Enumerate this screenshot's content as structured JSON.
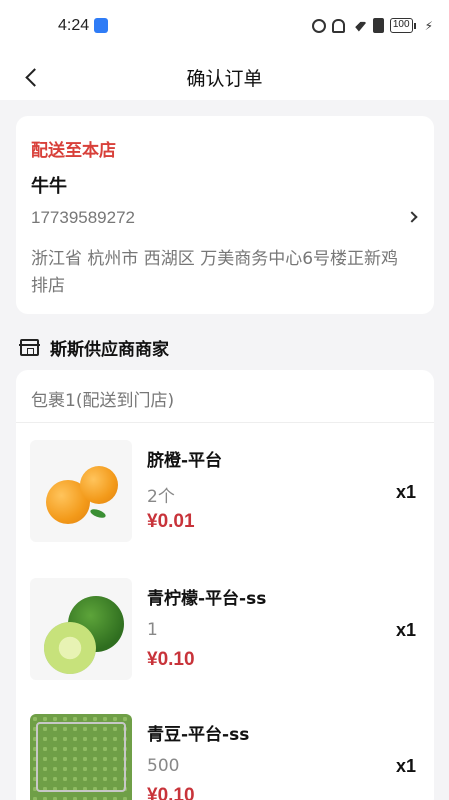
{
  "status_bar": {
    "time": "4:24",
    "battery": "100",
    "icons": [
      "alarm-icon",
      "mute-icon",
      "wifi-icon",
      "sim-icon",
      "battery-icon",
      "charging-icon"
    ]
  },
  "nav": {
    "title": "确认订单",
    "back_icon": "chevron-left-icon"
  },
  "address": {
    "delivery_label": "配送至本店",
    "name": "牛牛",
    "phone": "17739589272",
    "address": "浙江省 杭州市 西湖区 万美商务中心6号楼正新鸡排店"
  },
  "store": {
    "name": "斯斯供应商商家",
    "icon": "store-icon"
  },
  "package": {
    "title": "包裹1(配送到门店)",
    "items": [
      {
        "name": "脐橙-平台",
        "spec": "2个",
        "price": "¥0.01",
        "qty": "x1",
        "image": "orange"
      },
      {
        "name": "青柠檬-平台-ss",
        "spec": "1",
        "price": "¥0.10",
        "qty": "x1",
        "image": "lime"
      },
      {
        "name": "青豆-平台-ss",
        "spec": "500",
        "price": "¥0.10",
        "qty": "x1",
        "image": "green-peas"
      }
    ]
  },
  "colors": {
    "accent": "#d8403a",
    "price": "#c8333a",
    "background": "#f4f4f6"
  }
}
